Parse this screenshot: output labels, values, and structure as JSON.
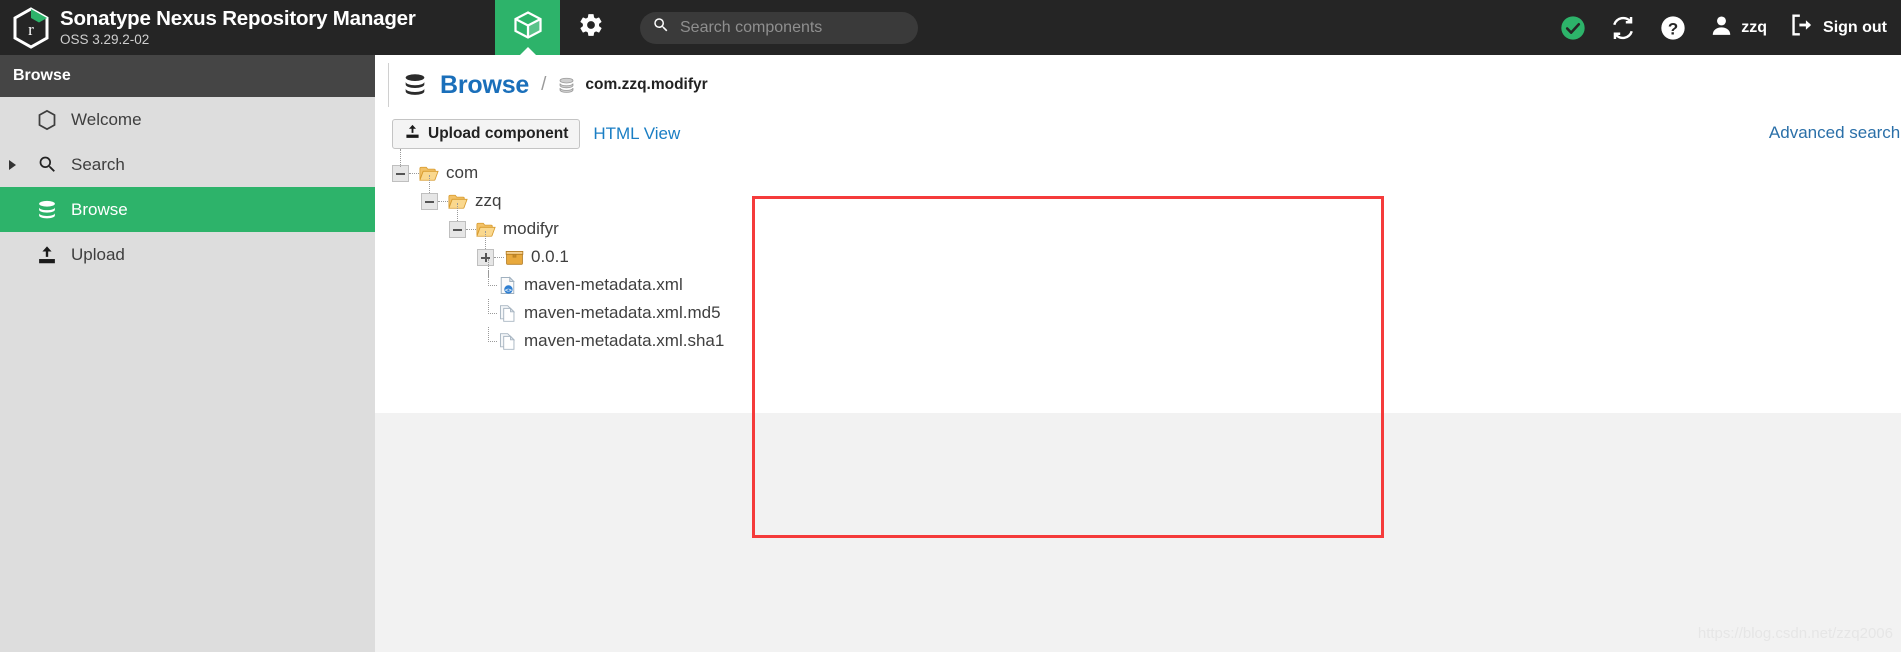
{
  "header": {
    "brand_title": "Sonatype Nexus Repository Manager",
    "brand_subtitle": "OSS 3.29.2-02",
    "logo_icon": "nexus-hexagon-logo-icon",
    "browse_tab_icon": "cube-icon",
    "admin_icon": "gear-icon",
    "search": {
      "icon": "search-icon",
      "value": "",
      "placeholder": "Search components"
    },
    "status_icon": "green-check-circle-icon",
    "refresh_icon": "refresh-icon",
    "help_icon": "help-question-icon",
    "user_icon": "user-avatar-icon",
    "user_name": "zzq",
    "signout_icon": "sign-out-icon",
    "signout_label": "Sign out",
    "accent_green": "#2db36a",
    "background": "#252525"
  },
  "sidebar": {
    "title": "Browse",
    "items": [
      {
        "label": "Welcome",
        "icon": "hexagon-icon",
        "active": false,
        "expandable": false
      },
      {
        "label": "Search",
        "icon": "search-icon",
        "active": false,
        "expandable": true
      },
      {
        "label": "Browse",
        "icon": "database-icon",
        "active": true,
        "expandable": false
      },
      {
        "label": "Upload",
        "icon": "upload-icon",
        "active": false,
        "expandable": false
      }
    ]
  },
  "main": {
    "breadcrumb": {
      "root_icon": "database-icon",
      "root_label": "Browse",
      "separator": "/",
      "repo_icon": "repository-icon",
      "repo_label": "com.zzq.modifyr"
    },
    "toolbar": {
      "upload_icon": "upload-icon",
      "upload_label": "Upload component",
      "html_view_label": "HTML View",
      "advanced_search_label": "Advanced search."
    },
    "tree": [
      {
        "depth": 0,
        "label": "com",
        "icon": "folder-open-icon",
        "toggle": "minus",
        "type": "folder"
      },
      {
        "depth": 1,
        "label": "zzq",
        "icon": "folder-open-icon",
        "toggle": "minus",
        "type": "folder"
      },
      {
        "depth": 2,
        "label": "modifyr",
        "icon": "folder-open-icon",
        "toggle": "minus",
        "type": "folder"
      },
      {
        "depth": 3,
        "label": "0.0.1",
        "icon": "package-icon",
        "toggle": "plus",
        "type": "component"
      },
      {
        "depth": 3,
        "label": "maven-metadata.xml",
        "icon": "xml-file-icon",
        "toggle": "none",
        "type": "file"
      },
      {
        "depth": 3,
        "label": "maven-metadata.xml.md5",
        "icon": "file-copy-icon",
        "toggle": "none",
        "type": "file"
      },
      {
        "depth": 3,
        "label": "maven-metadata.xml.sha1",
        "icon": "file-copy-icon",
        "toggle": "none",
        "type": "file"
      }
    ],
    "annotation": {
      "color": "#f53b3b",
      "shape": "rectangle"
    }
  },
  "watermark": "https://blog.csdn.net/zzq2006"
}
